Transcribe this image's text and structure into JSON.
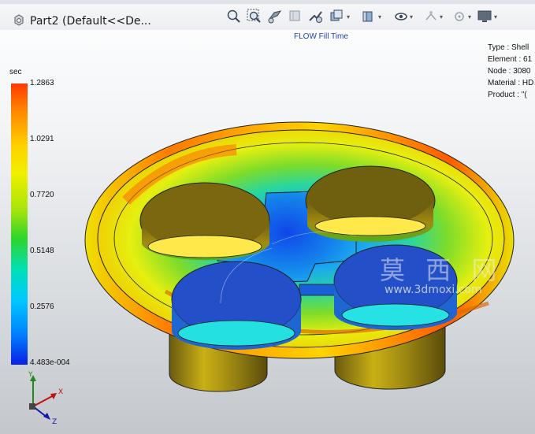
{
  "header": {
    "part_title": "Part2  (Default<<De...",
    "simulation_title": "FLOW Fill Time"
  },
  "toolbar": {
    "icons": [
      "zoom-to-fit-icon",
      "zoom-to-area-icon",
      "rotate-view-icon",
      "section-view-icon",
      "view-orientation-icon",
      "display-style-icon",
      "hide-show-icon",
      "edit-appearance-icon",
      "apply-scene-icon",
      "view-settings-icon"
    ]
  },
  "info": {
    "type": "Type : Shell",
    "element": "Element : 61",
    "node": "Node : 3080",
    "material": "Material : HD",
    "product": "Product :   \"("
  },
  "legend": {
    "unit": "sec",
    "ticks": [
      "1.2863",
      "1.0291",
      "0.7720",
      "0.5148",
      "0.2576",
      "4.483e-004"
    ],
    "colors": {
      "max": "#ff3a00",
      "mid": "#2fd52a",
      "min": "#0a1ee6"
    }
  },
  "triad": {
    "x": "X",
    "y": "Y",
    "z": "Z"
  },
  "watermark": {
    "text_cn": "莫 西 网",
    "url": "www.3dmoxi.com"
  }
}
